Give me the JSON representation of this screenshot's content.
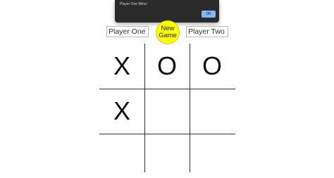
{
  "alert": {
    "message": "Player One Wins!",
    "ok_label": "OK"
  },
  "players": {
    "one_value": "Player One",
    "two_value": "Player Two"
  },
  "new_game": {
    "line1": "New",
    "line2": "Game"
  },
  "board": {
    "cells": [
      "X",
      "O",
      "O",
      "X",
      "",
      "",
      "",
      "",
      ""
    ]
  },
  "colors": {
    "new_game_button": "#ffff00",
    "alert_background": "#2b2b2b",
    "ok_button": "#8ab4f8"
  }
}
